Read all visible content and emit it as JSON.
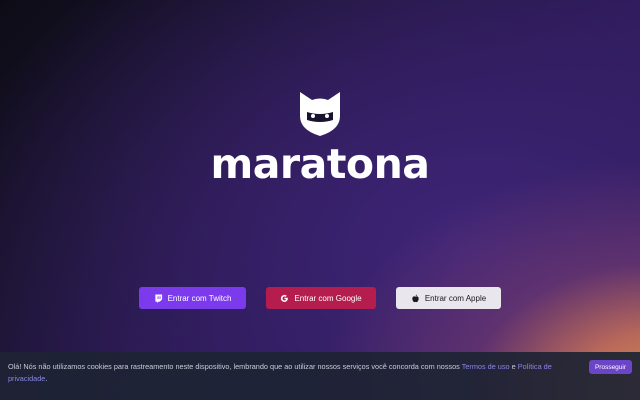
{
  "brand": {
    "name": "maratona",
    "logo_icon": "fox-mascot-icon"
  },
  "auth": {
    "twitch": {
      "label": "Entrar com Twitch",
      "icon": "twitch-icon",
      "color": "#7c3aed"
    },
    "google": {
      "label": "Entrar com Google",
      "icon": "google-icon",
      "color": "#b51d4e"
    },
    "apple": {
      "label": "Entrar com Apple",
      "icon": "apple-icon",
      "color": "#e9e6ee"
    }
  },
  "cookie": {
    "text_before": "Olá! Nós não utilizamos cookies para rastreamento neste dispositivo, lembrando que ao utilizar nossos serviços você concorda com nossos ",
    "terms_link": "Termos de uso",
    "conjunction": " e ",
    "privacy_link": "Política de privacidade",
    "text_after": ".",
    "accept_label": "Prosseguir"
  },
  "colors": {
    "accent": "#6b45c8",
    "link": "#8a86e8"
  }
}
